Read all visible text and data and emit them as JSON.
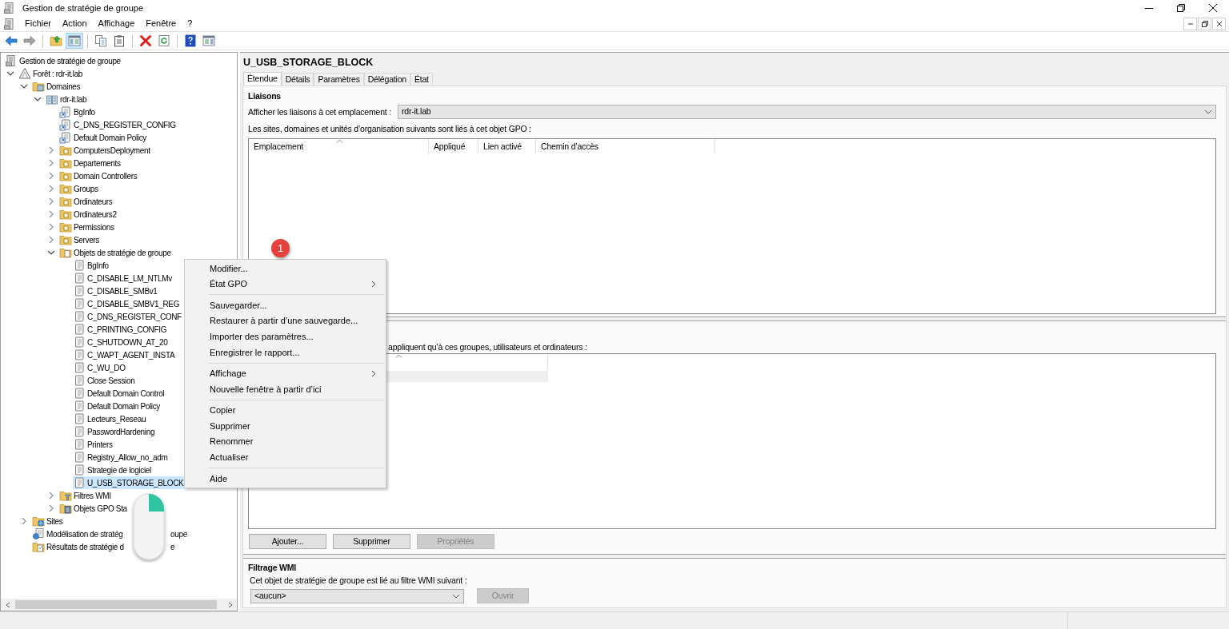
{
  "window": {
    "title": "Gestion de stratégie de groupe"
  },
  "menu_bar": [
    "Fichier",
    "Action",
    "Affichage",
    "Fenêtre",
    "?"
  ],
  "toolbar": [
    {
      "kind": "back",
      "disabled": false,
      "pressed": false
    },
    {
      "kind": "forward",
      "disabled": true,
      "pressed": false
    },
    {
      "kind": "up",
      "disabled": false,
      "pressed": false
    },
    {
      "kind": "tree-toggle",
      "disabled": false,
      "pressed": true
    },
    {
      "kind": "copy",
      "disabled": false,
      "pressed": false
    },
    {
      "kind": "paste",
      "disabled": false,
      "pressed": false
    },
    {
      "kind": "delete",
      "disabled": false,
      "pressed": false
    },
    {
      "kind": "refresh",
      "disabled": false,
      "pressed": false
    },
    {
      "kind": "help",
      "disabled": false,
      "pressed": false
    },
    {
      "kind": "action-pane",
      "disabled": false,
      "pressed": false
    }
  ],
  "tree": [
    {
      "label": "Gestion de stratégie de groupe",
      "kind": "console",
      "selected": false,
      "children": [
        {
          "label": "Forêt : rdr-it.lab",
          "kind": "forest",
          "expanded": true,
          "selected": false,
          "children": [
            {
              "label": "Domaines",
              "kind": "domains",
              "expanded": true,
              "selected": false,
              "children": [
                {
                  "label": "rdr-it.lab",
                  "kind": "domain",
                  "expanded": true,
                  "selected": false,
                  "children": [
                    {
                      "label": "BgInfo",
                      "kind": "gpo-link",
                      "selected": false
                    },
                    {
                      "label": "C_DNS_REGISTER_CONFIG",
                      "kind": "gpo-link",
                      "selected": false
                    },
                    {
                      "label": "Default Domain Policy",
                      "kind": "gpo-link",
                      "selected": false
                    },
                    {
                      "label": "ComputersDeployment",
                      "kind": "ou",
                      "expanded": false,
                      "selected": false
                    },
                    {
                      "label": "Departements",
                      "kind": "ou",
                      "expanded": false,
                      "selected": false
                    },
                    {
                      "label": "Domain Controllers",
                      "kind": "ou",
                      "expanded": false,
                      "selected": false
                    },
                    {
                      "label": "Groups",
                      "kind": "ou",
                      "expanded": false,
                      "selected": false
                    },
                    {
                      "label": "Ordinateurs",
                      "kind": "ou",
                      "expanded": false,
                      "selected": false
                    },
                    {
                      "label": "Ordinateurs2",
                      "kind": "ou",
                      "expanded": false,
                      "selected": false
                    },
                    {
                      "label": "Permissions",
                      "kind": "ou",
                      "expanded": false,
                      "selected": false
                    },
                    {
                      "label": "Servers",
                      "kind": "ou",
                      "expanded": false,
                      "selected": false
                    },
                    {
                      "label": "Objets de stratégie de groupe",
                      "kind": "gpo-folder",
                      "expanded": true,
                      "selected": false,
                      "children": [
                        {
                          "label": "BgInfo",
                          "kind": "gpo",
                          "selected": false
                        },
                        {
                          "label": "C_DISABLE_LM_NTLMv",
                          "kind": "gpo",
                          "selected": false
                        },
                        {
                          "label": "C_DISABLE_SMBv1",
                          "kind": "gpo",
                          "selected": false
                        },
                        {
                          "label": "C_DISABLE_SMBV1_REG",
                          "kind": "gpo",
                          "selected": false
                        },
                        {
                          "label": "C_DNS_REGISTER_CONF",
                          "kind": "gpo",
                          "selected": false
                        },
                        {
                          "label": "C_PRINTING_CONFIG",
                          "kind": "gpo",
                          "selected": false
                        },
                        {
                          "label": "C_SHUTDOWN_AT_20",
                          "kind": "gpo",
                          "selected": false
                        },
                        {
                          "label": "C_WAPT_AGENT_INSTA",
                          "kind": "gpo",
                          "selected": false
                        },
                        {
                          "label": "C_WU_DO",
                          "kind": "gpo",
                          "selected": false
                        },
                        {
                          "label": "Close Session",
                          "kind": "gpo",
                          "selected": false
                        },
                        {
                          "label": "Default Domain Control",
                          "kind": "gpo",
                          "selected": false
                        },
                        {
                          "label": "Default Domain Policy",
                          "kind": "gpo",
                          "selected": false
                        },
                        {
                          "label": "Lecteurs_Reseau",
                          "kind": "gpo",
                          "selected": false
                        },
                        {
                          "label": "PasswordHardening",
                          "kind": "gpo",
                          "selected": false
                        },
                        {
                          "label": "Printers",
                          "kind": "gpo",
                          "selected": false
                        },
                        {
                          "label": "Registry_Allow_no_adm",
                          "kind": "gpo",
                          "selected": false
                        },
                        {
                          "label": "Strategie de logiciel",
                          "kind": "gpo",
                          "selected": false
                        },
                        {
                          "label": "U_USB_STORAGE_BLOCK",
                          "kind": "gpo",
                          "selected": true
                        }
                      ]
                    },
                    {
                      "label": "Filtres WMI",
                      "kind": "wmi-folder",
                      "expanded": false,
                      "selected": false
                    },
                    {
                      "label": "Objets GPO Sta",
                      "kind": "starter-folder",
                      "expanded": false,
                      "selected": false
                    }
                  ]
                }
              ]
            },
            {
              "label": "Sites",
              "kind": "sites",
              "expanded": false,
              "selected": false
            },
            {
              "label": "Modélisation de stratég",
              "label_tail": "oupe",
              "kind": "modeling",
              "selected": false
            },
            {
              "label": "Résultats de stratégie d",
              "label_tail": "e",
              "kind": "results",
              "selected": false
            }
          ]
        }
      ]
    }
  ],
  "details": {
    "title": "U_USB_STORAGE_BLOCK",
    "tabs": [
      {
        "label": "Étendue",
        "selected": true
      },
      {
        "label": "Détails",
        "selected": false
      },
      {
        "label": "Paramètres",
        "selected": false
      },
      {
        "label": "Délégation",
        "selected": false
      },
      {
        "label": "État",
        "selected": false
      }
    ],
    "links": {
      "heading": "Liaisons",
      "location_label": "Afficher les liaisons à cet emplacement :",
      "location_value": "rdr-it.lab",
      "description": "Les sites, domaines et unités d’organisation suivants sont liés à cet objet GPO :",
      "columns": [
        {
          "label": "Emplacement",
          "sorted": true
        },
        {
          "label": "Appliqué",
          "sorted": false
        },
        {
          "label": "Lien activé",
          "sorted": false
        },
        {
          "label": "Chemin d’accès",
          "sorted": false
        }
      ]
    },
    "security_filter": {
      "description": "appliquent qu’à ces groupes, utilisateurs et ordinateurs :",
      "columns": [
        {
          "sorted": true
        }
      ],
      "rows": [
        {
          "selected": true
        }
      ],
      "buttons": [
        {
          "label": "Ajouter...",
          "disabled": false
        },
        {
          "label": "Supprimer",
          "disabled": false
        },
        {
          "label": "Propriétés",
          "disabled": true
        }
      ]
    },
    "wmi_filter": {
      "heading": "Filtrage WMI",
      "description": "Cet objet de stratégie de groupe est lié au filtre WMI suivant :",
      "value": "<aucun>",
      "button": {
        "label": "Ouvrir",
        "disabled": true
      }
    }
  },
  "context_menu": {
    "groups": [
      [
        {
          "label": "Modifier...",
          "submenu": false
        },
        {
          "label": "État GPO",
          "submenu": true
        }
      ],
      [
        {
          "label": "Sauvegarder...",
          "submenu": false
        },
        {
          "label": "Restaurer à partir d’une sauvegarde...",
          "submenu": false
        },
        {
          "label": "Importer des paramètres...",
          "submenu": false
        },
        {
          "label": "Enregistrer le rapport...",
          "submenu": false
        }
      ],
      [
        {
          "label": "Affichage",
          "submenu": true
        },
        {
          "label": "Nouvelle fenêtre à partir d’ici",
          "submenu": false
        }
      ],
      [
        {
          "label": "Copier",
          "submenu": false
        },
        {
          "label": "Supprimer",
          "submenu": false
        },
        {
          "label": "Renommer",
          "submenu": false
        },
        {
          "label": "Actualiser",
          "submenu": false
        }
      ],
      [
        {
          "label": "Aide",
          "submenu": false
        }
      ]
    ]
  },
  "annotation": {
    "step": "1"
  }
}
